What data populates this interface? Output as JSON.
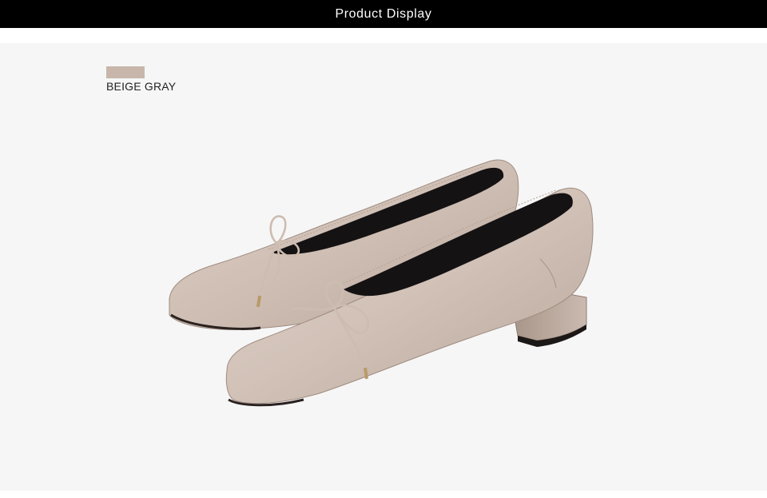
{
  "header": {
    "title": "Product Display",
    "background_color": "#000000",
    "text_color": "#ffffff"
  },
  "product": {
    "color_name": "BEIGE GRAY",
    "swatch_color": "#c8b6ab",
    "image_subject": "pair-of-beige-gray-square-toe-ballet-flats-with-bow"
  }
}
